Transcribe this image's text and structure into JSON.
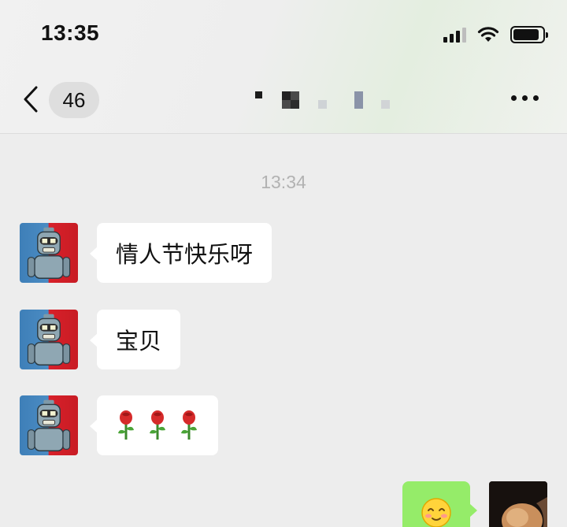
{
  "status_bar": {
    "time": "13:35",
    "signal_bars": 4,
    "signal_bars_active": 3,
    "battery_level": 0.9,
    "icons": [
      "signal-icon",
      "wifi-icon",
      "battery-icon"
    ]
  },
  "header": {
    "back_icon": "chevron-left-icon",
    "unread_count": "46",
    "contact_name_pixelated": true,
    "more_icon": "ellipsis-icon"
  },
  "chat": {
    "timestamp": "13:34",
    "incoming": [
      {
        "type": "text",
        "text": "情人节快乐呀"
      },
      {
        "type": "text",
        "text": "宝贝"
      },
      {
        "type": "emoji",
        "emojis": [
          "rose-emoji",
          "rose-emoji",
          "rose-emoji"
        ]
      }
    ],
    "outgoing": [
      {
        "type": "emoji",
        "emojis": [
          "smiling-face-emoji"
        ]
      }
    ]
  },
  "colors": {
    "chat_background": "#ededed",
    "incoming_bubble": "#ffffff",
    "outgoing_bubble": "#95ec69",
    "timestamp_text": "#b2b2b2",
    "badge_background": "#dedede"
  }
}
